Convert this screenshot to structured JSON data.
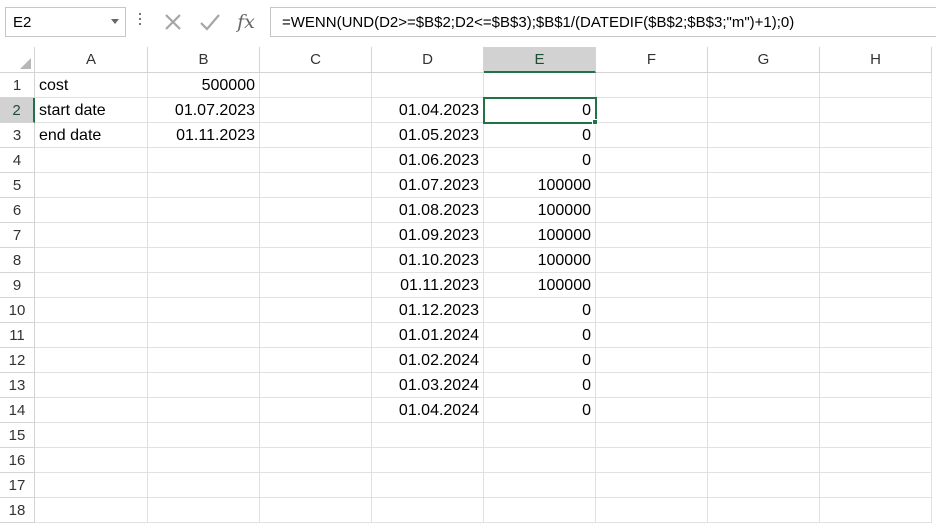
{
  "name_box": {
    "value": "E2"
  },
  "formula_bar": {
    "cancel_icon": "cancel-x-icon",
    "enter_icon": "enter-check-icon",
    "fx_label": "fx",
    "formula": "=WENN(UND(D2>=$B$2;D2<=$B$3);$B$1/(DATEDIF($B$2;$B$3;\"m\")+1);0)"
  },
  "columns": [
    "A",
    "B",
    "C",
    "D",
    "E",
    "F",
    "G",
    "H"
  ],
  "rows": [
    "1",
    "2",
    "3",
    "4",
    "5",
    "6",
    "7",
    "8",
    "9",
    "10",
    "11",
    "12",
    "13",
    "14",
    "15",
    "16",
    "17",
    "18"
  ],
  "selected_cell": {
    "column": "E",
    "row": "2"
  },
  "cells": {
    "A1": "cost",
    "B1": "500000",
    "A2": "start date",
    "B2": "01.07.2023",
    "A3": "end date",
    "B3": "01.11.2023",
    "D2": "01.04.2023",
    "E2": "0",
    "D3": "01.05.2023",
    "E3": "0",
    "D4": "01.06.2023",
    "E4": "0",
    "D5": "01.07.2023",
    "E5": "100000",
    "D6": "01.08.2023",
    "E6": "100000",
    "D7": "01.09.2023",
    "E7": "100000",
    "D8": "01.10.2023",
    "E8": "100000",
    "D9": "01.11.2023",
    "E9": "100000",
    "D10": "01.12.2023",
    "E10": "0",
    "D11": "01.01.2024",
    "E11": "0",
    "D12": "01.02.2024",
    "E12": "0",
    "D13": "01.03.2024",
    "E13": "0",
    "D14": "01.04.2024",
    "E14": "0"
  },
  "colors": {
    "accent": "#217346",
    "header_selected": "#d2d2d2",
    "gridline": "#e1e1e1"
  }
}
